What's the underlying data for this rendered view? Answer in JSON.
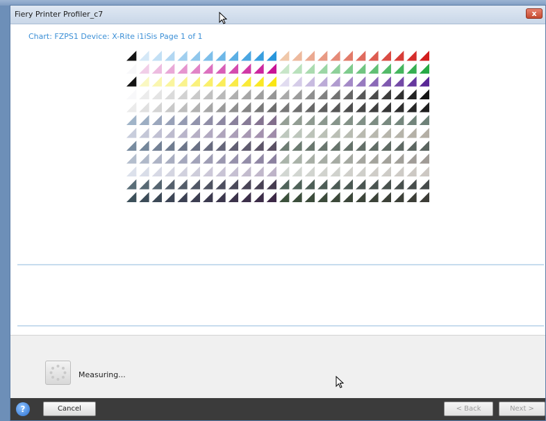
{
  "window": {
    "title": "Fiery Printer Profiler_c7",
    "close_glyph": "x"
  },
  "chart_info": {
    "text": "Chart: FZPS1  Device: X-Rite i1iSis  Page 1 of 1"
  },
  "status": {
    "text": "Measuring..."
  },
  "footer": {
    "help_glyph": "?",
    "cancel_label": "Cancel",
    "back_label": "< Back",
    "next_label": "Next >"
  },
  "icons": [
    "help-icon",
    "close-icon",
    "spinner-icon",
    "mouse-cursor-icon"
  ],
  "colors": {
    "accent_text": "#3b8fd6",
    "footer_bg": "#3b3b3b",
    "close_button": "#c44a30"
  }
}
